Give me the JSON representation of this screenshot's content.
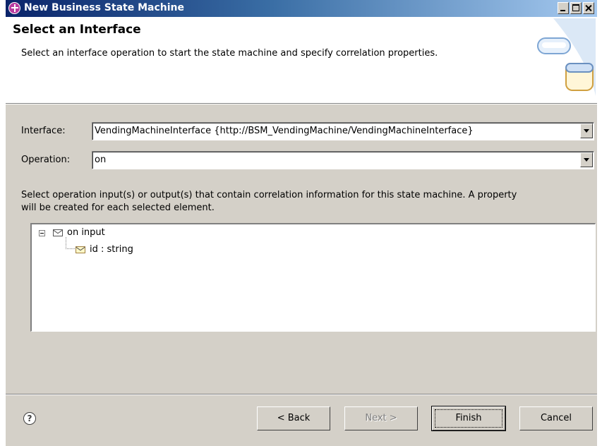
{
  "window": {
    "title": "New Business State Machine"
  },
  "header": {
    "title": "Select an Interface",
    "description": "Select an interface operation to start the state machine and specify correlation properties."
  },
  "form": {
    "interface_label": "Interface:",
    "interface_value": "VendingMachineInterface  {http://BSM_VendingMachine/VendingMachineInterface}",
    "operation_label": "Operation:",
    "operation_value": "on",
    "instructions": "Select operation input(s) or output(s) that contain correlation information for this state machine. A property will be created for each selected element."
  },
  "tree": {
    "items": [
      {
        "label": "on input",
        "icon": "envelope-icon",
        "expanded": true
      },
      {
        "label": "id : string",
        "icon": "message-part-icon"
      }
    ]
  },
  "footer": {
    "back_label": "< Back",
    "next_label": "Next >",
    "finish_label": "Finish",
    "cancel_label": "Cancel",
    "help_glyph": "?"
  },
  "colors": {
    "titlebar_start": "#0a246a",
    "titlebar_end": "#a6caf0",
    "dialog_bg": "#d4d0c8"
  }
}
